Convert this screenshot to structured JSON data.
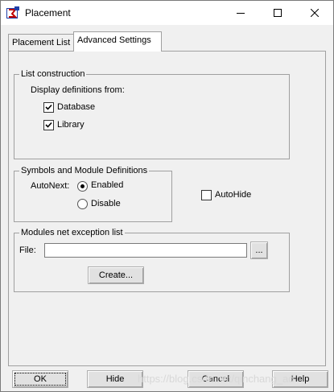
{
  "window": {
    "title": "Placement"
  },
  "tabs": [
    {
      "label": "Placement List",
      "active": false
    },
    {
      "label": "Advanced Settings",
      "active": true
    }
  ],
  "list_construction": {
    "legend": "List construction",
    "display_label": "Display definitions from:",
    "database": {
      "label": "Database",
      "checked": true
    },
    "library": {
      "label": "Library",
      "checked": true
    }
  },
  "symbols": {
    "legend": "Symbols and Module Definitions",
    "autonext_label": "AutoNext:",
    "enabled": {
      "label": "Enabled",
      "selected": true
    },
    "disable": {
      "label": "Disable",
      "selected": false
    }
  },
  "autohide": {
    "label": "AutoHide",
    "checked": false
  },
  "modules": {
    "legend": "Modules net exception list",
    "file_label": "File:",
    "file_value": "",
    "browse_label": "...",
    "create_label": "Create..."
  },
  "footer": {
    "ok": "OK",
    "hide": "Hide",
    "cancel": "Cancel",
    "help": "Help"
  },
  "watermark": "https://blog.csdn.net/qinchang_ad"
}
